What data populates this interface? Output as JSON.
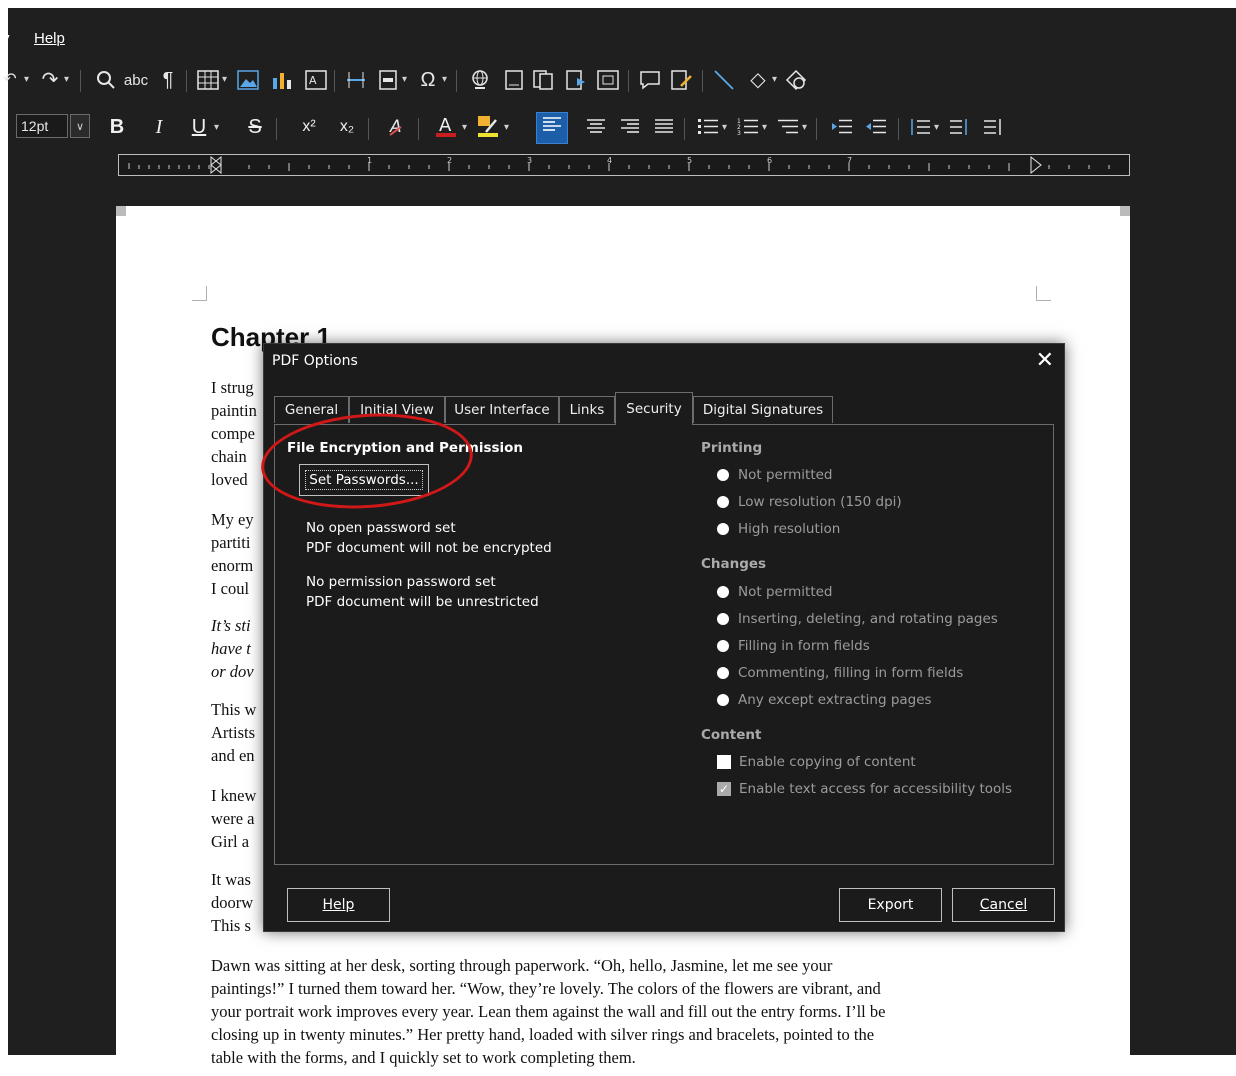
{
  "menu": {
    "prev_fragment": "v",
    "help": "Help"
  },
  "format_toolbar": {
    "font_size": "12pt",
    "bold": "B",
    "italic": "I",
    "underline": "U",
    "strike": "S",
    "superscript": "x²",
    "subscript": "x₂"
  },
  "document": {
    "chapter_title": "Chapter 1",
    "paragraphs_left": [
      "I strug\npaintin\ncompe\nchain\nloved",
      "My ey\npartiti\nenorm\nI coul",
      "It’s sti\nhave t\nor dov",
      "This w\nArtists\nand en",
      "I knew\nwere a\nGirl a",
      "It was\ndoorw\nThis s"
    ],
    "bottom_paragraph": "Dawn was sitting at her desk, sorting through paperwork. “Oh, hello, Jasmine, let me see your\npaintings!” I turned them toward her. “Wow, they’re lovely. The colors of the flowers are vibrant, and\nyour portrait work improves every year. Lean them against the wall and fill out the entry forms. I’ll be\nclosing up in twenty minutes.” Her pretty hand, loaded with silver rings and bracelets, pointed to the\ntable with the forms, and I quickly set to work completing them."
  },
  "dialog": {
    "title": "PDF Options",
    "close_glyph": "✕",
    "tabs": [
      {
        "label": "General"
      },
      {
        "label": "Initial View"
      },
      {
        "label": "User Interface"
      },
      {
        "label": "Links"
      },
      {
        "label": "Security",
        "active": true
      },
      {
        "label": "Digital Signatures"
      }
    ],
    "encryption_title": "File Encryption and Permission",
    "set_passwords": "Set Passwords...",
    "open_pw_status": "No open password set",
    "open_pw_note": "PDF document will not be encrypted",
    "perm_pw_status": "No permission password set",
    "perm_pw_note": "PDF document will be unrestricted",
    "printing_title": "Printing",
    "printing_options": [
      "Not permitted",
      "Low resolution (150 dpi)",
      "High resolution"
    ],
    "changes_title": "Changes",
    "changes_options": [
      "Not permitted",
      "Inserting, deleting, and rotating pages",
      "Filling in form fields",
      "Commenting, filling in form fields",
      "Any except extracting pages"
    ],
    "content_title": "Content",
    "content_options": [
      {
        "label": "Enable copying of content",
        "checked": false
      },
      {
        "label": "Enable text access for accessibility tools",
        "checked": true
      }
    ],
    "help_button": "Help",
    "export_button": "Export",
    "cancel_button": "Cancel"
  },
  "annotation": {
    "color": "#d01818",
    "target": "Set Passwords..."
  }
}
